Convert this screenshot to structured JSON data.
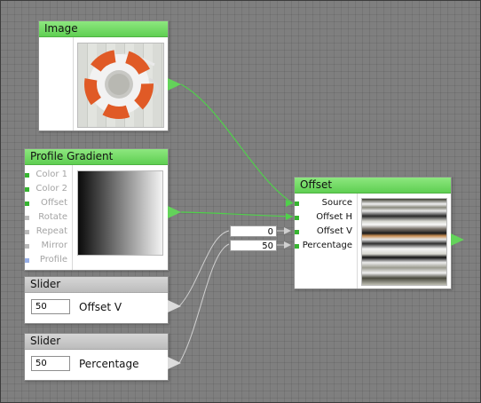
{
  "nodes": {
    "image": {
      "title": "Image"
    },
    "profile_gradient": {
      "title": "Profile Gradient",
      "ports": [
        "Color 1",
        "Color 2",
        "Offset",
        "Rotate",
        "Repeat",
        "Mirror",
        "Profile"
      ]
    },
    "offset": {
      "title": "Offset",
      "ports": [
        "Source",
        "Offset H",
        "Offset V",
        "Percentage"
      ],
      "inline_values": {
        "offset_v": "0",
        "percentage": "50"
      }
    },
    "slider_offset_v": {
      "title": "Slider",
      "value": "50",
      "label": "Offset V"
    },
    "slider_percentage": {
      "title": "Slider",
      "value": "50",
      "label": "Percentage"
    }
  },
  "colors": {
    "node_header_green": "#6fd962",
    "node_header_gray": "#c8c8c8",
    "canvas": "#7f7f7f",
    "wire_green": "#4fd14a",
    "wire_gray": "#cfcfcf"
  }
}
